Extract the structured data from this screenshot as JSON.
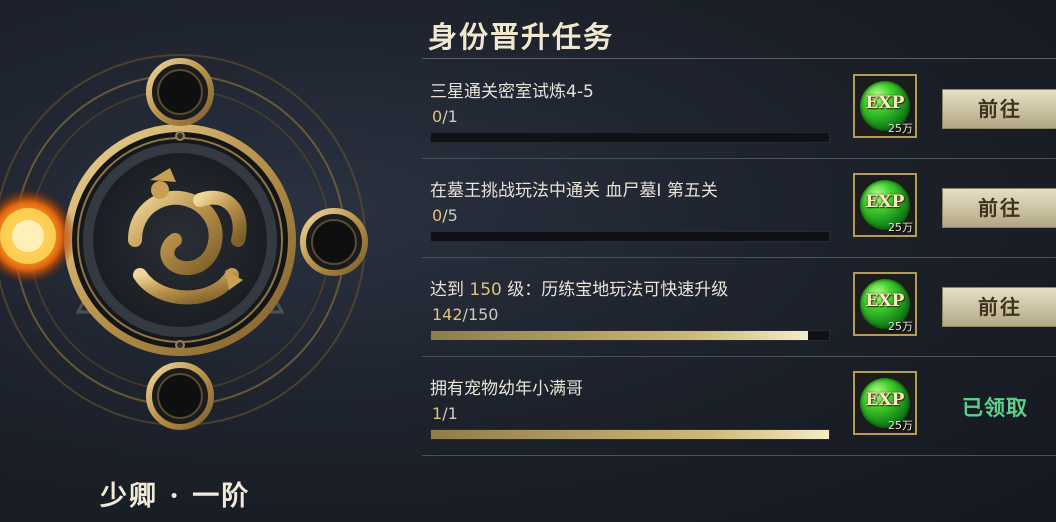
{
  "rank": {
    "title": "少卿 · 一阶"
  },
  "panel": {
    "title": "身份晋升任务",
    "tasks": [
      {
        "desc": "三星通关密室试炼4-5",
        "progress_current": "0",
        "progress_total": "1",
        "progress_fraction": 0,
        "reward": {
          "label": "EXP",
          "amount": "25万"
        },
        "action": "前往",
        "claimed": false
      },
      {
        "desc": "在墓王挑战玩法中通关 血尸墓I 第五关",
        "progress_current": "0",
        "progress_total": "5",
        "progress_fraction": 0,
        "reward": {
          "label": "EXP",
          "amount": "25万"
        },
        "action": "前往",
        "claimed": false
      },
      {
        "desc_prefix": "达到 ",
        "desc_highlight": "150",
        "desc_suffix": " 级：历练宝地玩法可快速升级",
        "progress_current": "142",
        "progress_total": "150",
        "progress_fraction": 0.947,
        "reward": {
          "label": "EXP",
          "amount": "25万"
        },
        "action": "前往",
        "claimed": false
      },
      {
        "desc": "拥有宠物幼年小满哥",
        "progress_current": "1",
        "progress_total": "1",
        "progress_fraction": 1,
        "reward": {
          "label": "EXP",
          "amount": "25万"
        },
        "status": "已领取",
        "claimed": true
      }
    ]
  },
  "colors": {
    "accent_gold": "#c8a55e",
    "claimed_green": "#5fd08b",
    "highlight": "#e2c178"
  },
  "icons": {
    "emblem": "dragon-emblem-icon",
    "orb": "fire-orb-icon",
    "reward": "exp-gem-icon"
  }
}
